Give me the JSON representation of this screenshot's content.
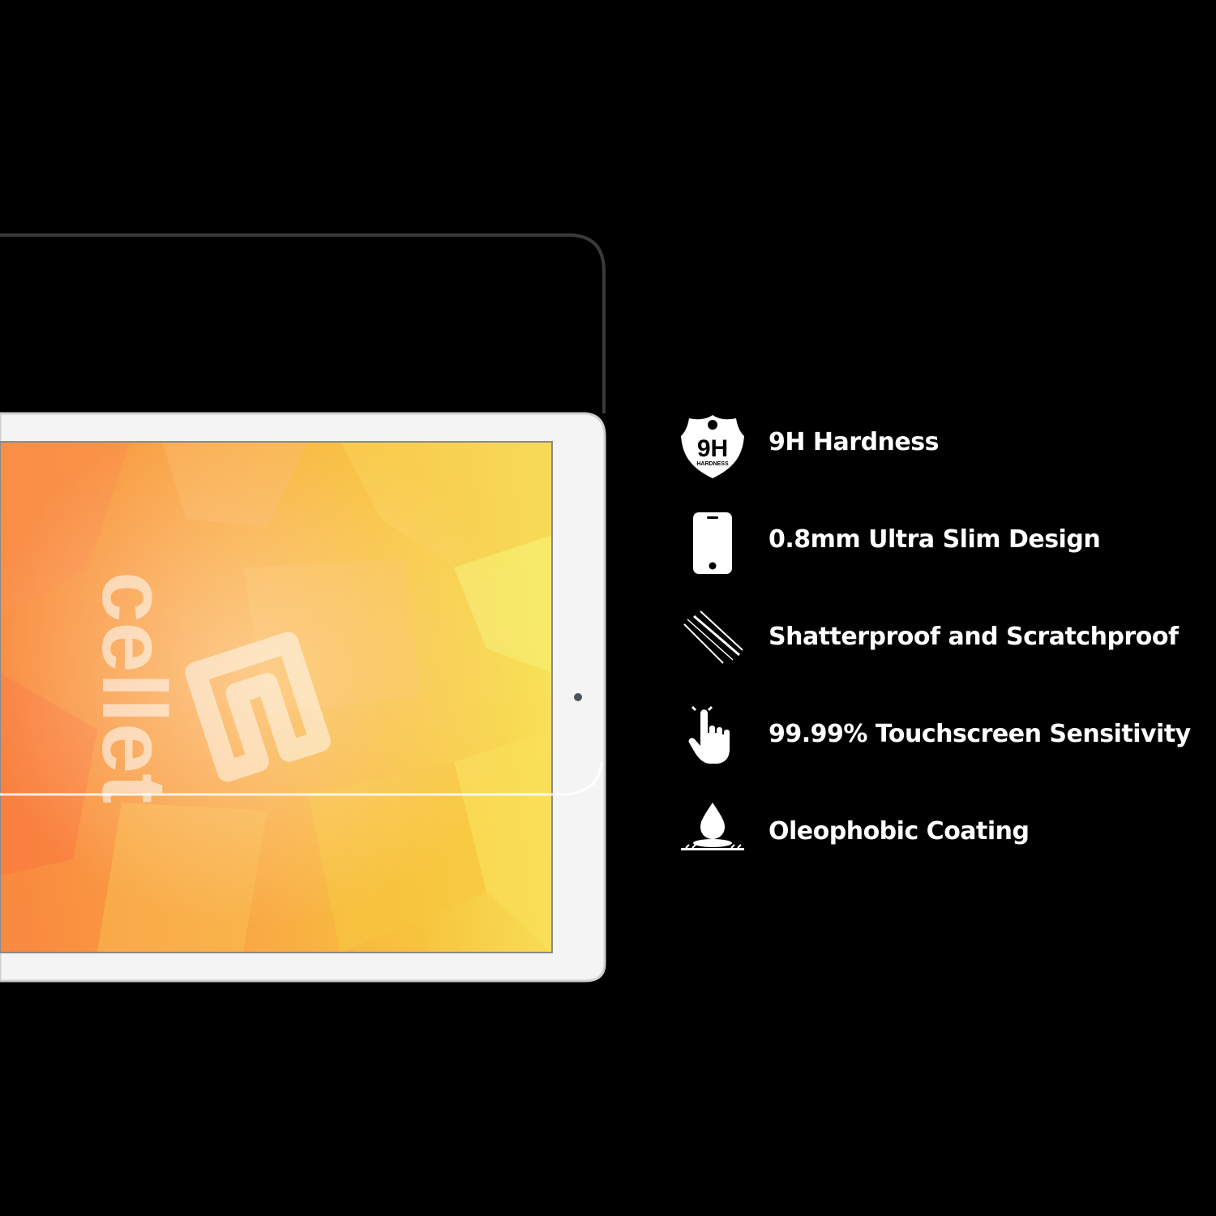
{
  "product": {
    "brand_watermark": "cellet"
  },
  "features": [
    {
      "icon": "9h-hardness-badge-icon",
      "label": "9H Hardness",
      "badge_top": "9H",
      "badge_bottom": "HARDNESS"
    },
    {
      "icon": "smartphone-icon",
      "label": "0.8mm Ultra Slim Design"
    },
    {
      "icon": "scratch-marks-icon",
      "label": "Shatterproof and Scratchproof"
    },
    {
      "icon": "pointing-hand-icon",
      "label": "99.99% Touchscreen Sensitivity"
    },
    {
      "icon": "water-drop-icon",
      "label": "Oleophobic Coating"
    }
  ],
  "colors": {
    "background": "#000000",
    "text": "#ffffff",
    "screen_orange": "#f7a23c",
    "screen_yellow": "#f9d84a",
    "tablet_frame": "#ffffff"
  }
}
